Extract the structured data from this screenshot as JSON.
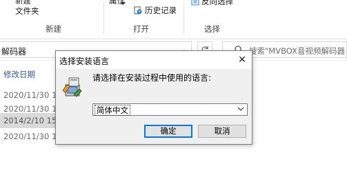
{
  "ribbon": {
    "new_item_partial": "新建",
    "new_folder_label": "文件夹",
    "properties_partial": "属性",
    "history_label": "历史记录",
    "invert_select_label": "反向选择",
    "groups": {
      "new": "新建",
      "open": "打开",
      "select": "选择"
    }
  },
  "address": {
    "path_partial": "解码器",
    "search_placeholder": "搜索\"MVBOX音视频解码器"
  },
  "file_list": {
    "column_header": "修改日期",
    "rows": [
      {
        "date": "2020/11/30 1",
        "selected": false
      },
      {
        "date": "2020/11/30 1",
        "selected": false
      },
      {
        "date": "2014/2/10 15",
        "selected": true
      },
      {
        "date": "2020/11/30 1",
        "selected": false
      }
    ]
  },
  "dialog": {
    "title": "选择安装语言",
    "close_glyph": "✕",
    "prompt": "请选择在安装过程中使用的语言:",
    "language_selected": "简体中文",
    "ok_label": "确定",
    "cancel_label": "取消"
  },
  "colors": {
    "dialog_bg": "#f0f0f0",
    "default_button_border": "#0078d7",
    "selected_row_bg": "#d9d9d9"
  }
}
